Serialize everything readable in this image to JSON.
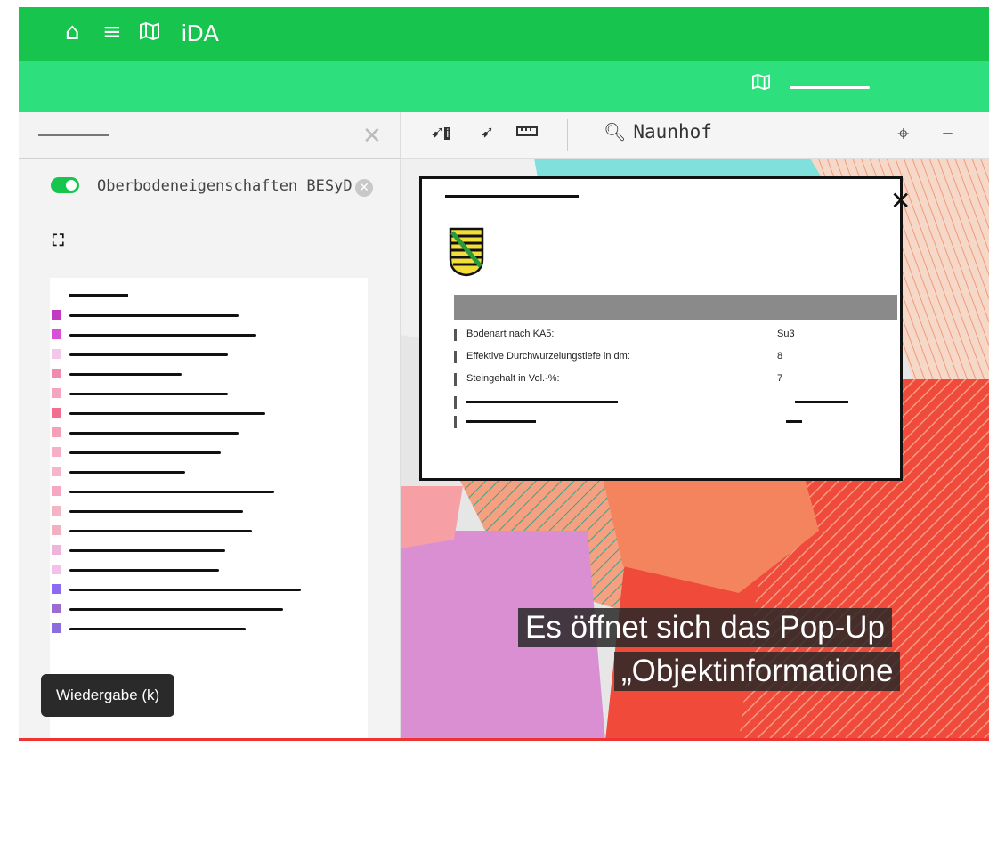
{
  "app": {
    "title": "iDA"
  },
  "topbar": {
    "home_icon": "home-icon",
    "menu_icon": "menu-icon",
    "map_icon": "map-icon"
  },
  "layer": {
    "name": "Oberbodeneigenschaften BESyD"
  },
  "maptools": {
    "search_value": "Naunhof"
  },
  "popup": {
    "properties": [
      {
        "key": "Bodenart nach KA5:",
        "value": "Su3"
      },
      {
        "key": "Effektive Durchwurzelungstiefe in dm:",
        "value": "8"
      },
      {
        "key": "Steingehalt in Vol.-%:",
        "value": "7"
      }
    ]
  },
  "subtitles": {
    "line1": "Es öffnet sich das Pop-Up",
    "line2": "„Objektinformatione"
  },
  "tooltip": {
    "text": "Wiedergabe (k)"
  },
  "colors": {
    "green_dark": "#16c44e",
    "green_light": "#2ee07d"
  }
}
